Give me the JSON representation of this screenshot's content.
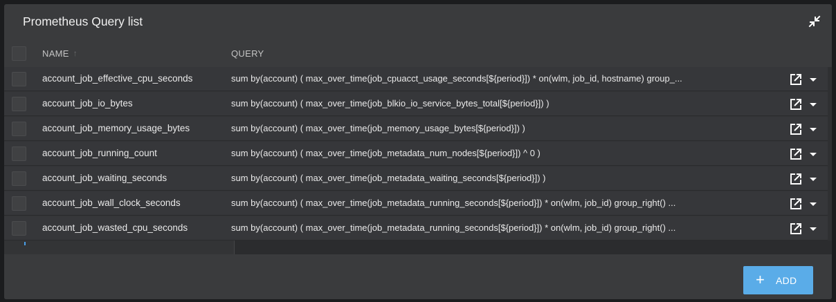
{
  "panel": {
    "title": "Prometheus Query list"
  },
  "icons": {
    "collapse": "collapse-arrows-icon",
    "open": "open-external-icon",
    "menu": "caret-down-icon",
    "sort": "sort-up-arrow-icon",
    "add": "plus-icon"
  },
  "table": {
    "columns": {
      "name": "NAME",
      "query": "QUERY"
    },
    "rows": [
      {
        "name": "account_job_effective_cpu_seconds",
        "query": "sum by(account) ( max_over_time(job_cpuacct_usage_seconds[${period}]) * on(wlm, job_id, hostname) group_..."
      },
      {
        "name": "account_job_io_bytes",
        "query": "sum by(account) ( max_over_time(job_blkio_io_service_bytes_total[${period}]) )"
      },
      {
        "name": "account_job_memory_usage_bytes",
        "query": "sum by(account) ( max_over_time(job_memory_usage_bytes[${period}]) )"
      },
      {
        "name": "account_job_running_count",
        "query": "sum by(account) ( max_over_time(job_metadata_num_nodes[${period}]) ^ 0 )"
      },
      {
        "name": "account_job_waiting_seconds",
        "query": "sum by(account) ( max_over_time(job_metadata_waiting_seconds[${period}]) )"
      },
      {
        "name": "account_job_wall_clock_seconds",
        "query": "sum by(account) ( max_over_time(job_metadata_running_seconds[${period}]) * on(wlm, job_id) group_right() ..."
      },
      {
        "name": "account_job_wasted_cpu_seconds",
        "query": "sum by(account) ( max_over_time(job_metadata_running_seconds[${period}]) * on(wlm, job_id) group_right() ..."
      }
    ]
  },
  "footer": {
    "add_label": "ADD",
    "add_plus": "+"
  },
  "colors": {
    "accent": "#5aace8",
    "panel_bg": "#3a3b3d",
    "row_bg": "#36373a"
  }
}
